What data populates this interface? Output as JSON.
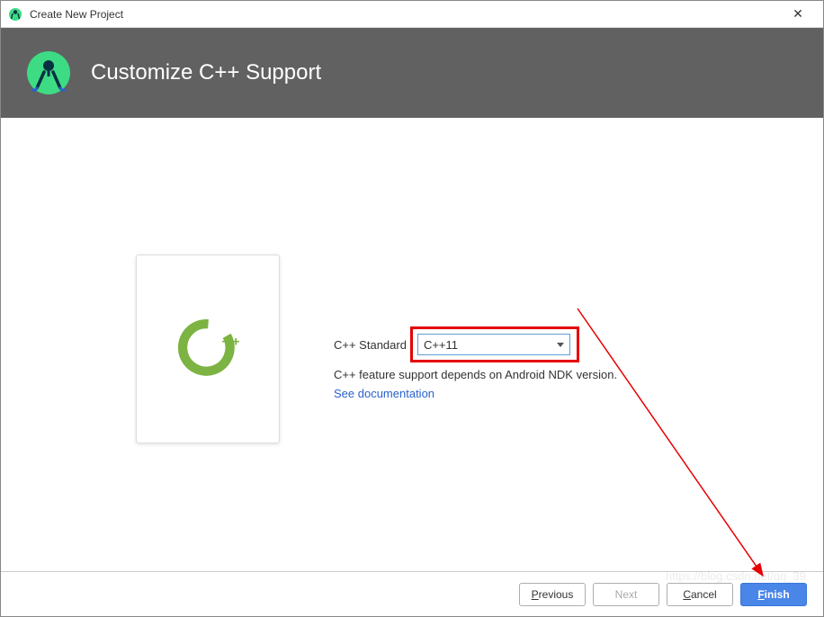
{
  "window": {
    "title": "Create New Project"
  },
  "header": {
    "title": "Customize C++ Support"
  },
  "form": {
    "standard_label": "C++ Standard",
    "standard_value": "C++11",
    "help_text": "C++ feature support depends on Android NDK version.",
    "doc_link": "See documentation"
  },
  "footer": {
    "previous": "Previous",
    "next": "Next",
    "cancel": "Cancel",
    "finish": "Finish"
  },
  "watermark": "https://blog.csdn.net/qq_39"
}
